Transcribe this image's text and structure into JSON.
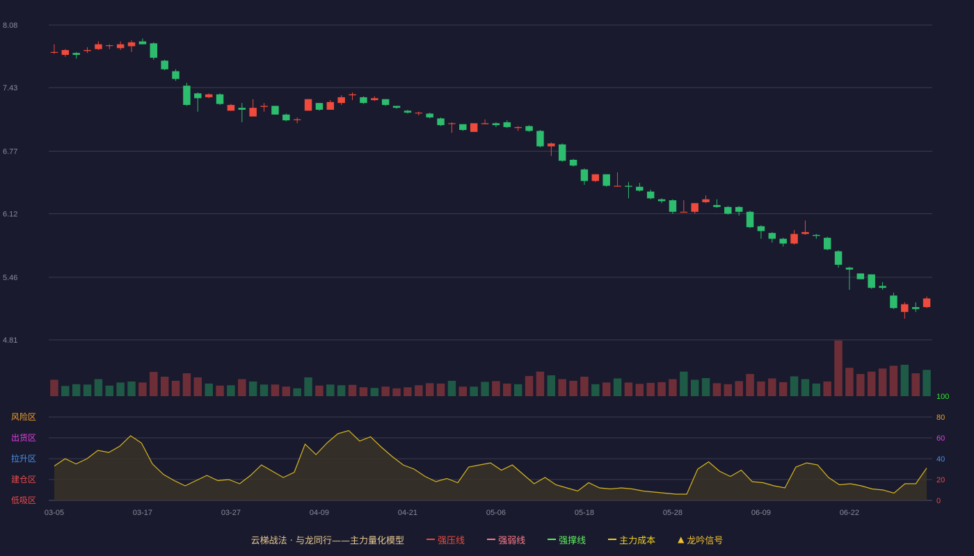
{
  "chart_data": {
    "type": "candlestick",
    "x_tick_labels": [
      "03-05",
      "03-17",
      "03-27",
      "04-09",
      "04-21",
      "05-06",
      "05-18",
      "05-28",
      "06-09",
      "06-22"
    ],
    "y_tick_labels": [
      "8.08",
      "7.43",
      "6.77",
      "6.12",
      "5.46",
      "4.81"
    ],
    "ylim": [
      4.81,
      8.08
    ],
    "grid": true,
    "candles": [
      [
        7.8,
        7.8,
        7.88,
        7.78
      ],
      [
        7.77,
        7.82,
        7.83,
        7.75
      ],
      [
        7.79,
        7.77,
        7.8,
        7.73
      ],
      [
        7.81,
        7.82,
        7.85,
        7.79
      ],
      [
        7.83,
        7.88,
        7.91,
        7.82
      ],
      [
        7.87,
        7.87,
        7.88,
        7.83
      ],
      [
        7.84,
        7.88,
        7.91,
        7.82
      ],
      [
        7.86,
        7.9,
        7.92,
        7.8
      ],
      [
        7.91,
        7.88,
        7.94,
        7.88
      ],
      [
        7.89,
        7.74,
        7.9,
        7.72
      ],
      [
        7.71,
        7.62,
        7.72,
        7.61
      ],
      [
        7.6,
        7.52,
        7.62,
        7.5
      ],
      [
        7.45,
        7.25,
        7.48,
        7.24
      ],
      [
        7.37,
        7.32,
        7.38,
        7.18
      ],
      [
        7.33,
        7.36,
        7.37,
        7.32
      ],
      [
        7.36,
        7.26,
        7.37,
        7.25
      ],
      [
        7.19,
        7.25,
        7.26,
        7.19
      ],
      [
        7.22,
        7.2,
        7.27,
        7.07
      ],
      [
        7.13,
        7.22,
        7.31,
        7.13
      ],
      [
        7.23,
        7.24,
        7.27,
        7.18
      ],
      [
        7.24,
        7.15,
        7.24,
        7.15
      ],
      [
        7.15,
        7.09,
        7.16,
        7.08
      ],
      [
        7.1,
        7.1,
        7.12,
        7.06
      ],
      [
        7.19,
        7.31,
        7.31,
        7.19
      ],
      [
        7.27,
        7.2,
        7.27,
        7.19
      ],
      [
        7.2,
        7.28,
        7.3,
        7.2
      ],
      [
        7.27,
        7.33,
        7.35,
        7.25
      ],
      [
        7.35,
        7.36,
        7.38,
        7.3
      ],
      [
        7.33,
        7.27,
        7.34,
        7.26
      ],
      [
        7.3,
        7.32,
        7.34,
        7.29
      ],
      [
        7.31,
        7.25,
        7.31,
        7.24
      ],
      [
        7.24,
        7.22,
        7.24,
        7.21
      ],
      [
        7.19,
        7.17,
        7.2,
        7.16
      ],
      [
        7.17,
        7.17,
        7.18,
        7.14
      ],
      [
        7.16,
        7.12,
        7.17,
        7.11
      ],
      [
        7.11,
        7.04,
        7.12,
        7.03
      ],
      [
        7.06,
        7.06,
        7.07,
        6.96
      ],
      [
        7.05,
        6.99,
        7.05,
        6.98
      ],
      [
        6.97,
        7.06,
        7.06,
        6.97
      ],
      [
        7.05,
        7.06,
        7.1,
        7.05
      ],
      [
        7.06,
        7.04,
        7.07,
        7.02
      ],
      [
        7.07,
        7.02,
        7.09,
        7.01
      ],
      [
        7.01,
        7.02,
        7.03,
        6.98
      ],
      [
        7.03,
        6.98,
        7.04,
        6.97
      ],
      [
        6.98,
        6.82,
        6.99,
        6.81
      ],
      [
        6.82,
        6.85,
        6.86,
        6.72
      ],
      [
        6.84,
        6.67,
        6.85,
        6.66
      ],
      [
        6.68,
        6.62,
        6.69,
        6.61
      ],
      [
        6.58,
        6.46,
        6.59,
        6.42
      ],
      [
        6.46,
        6.53,
        6.53,
        6.45
      ],
      [
        6.53,
        6.41,
        6.53,
        6.4
      ],
      [
        6.41,
        6.41,
        6.55,
        6.4
      ],
      [
        6.41,
        6.4,
        6.45,
        6.28
      ],
      [
        6.4,
        6.36,
        6.44,
        6.35
      ],
      [
        6.35,
        6.28,
        6.37,
        6.27
      ],
      [
        6.27,
        6.25,
        6.28,
        6.23
      ],
      [
        6.26,
        6.14,
        6.27,
        6.12
      ],
      [
        6.14,
        6.14,
        6.26,
        6.14
      ],
      [
        6.14,
        6.23,
        6.23,
        6.12
      ],
      [
        6.24,
        6.27,
        6.31,
        6.23
      ],
      [
        6.21,
        6.19,
        6.27,
        6.18
      ],
      [
        6.19,
        6.12,
        6.2,
        6.11
      ],
      [
        6.19,
        6.14,
        6.2,
        6.1
      ],
      [
        6.14,
        5.98,
        6.15,
        5.97
      ],
      [
        5.99,
        5.94,
        6.0,
        5.86
      ],
      [
        5.92,
        5.86,
        5.93,
        5.82
      ],
      [
        5.86,
        5.81,
        5.87,
        5.78
      ],
      [
        5.81,
        5.91,
        5.95,
        5.8
      ],
      [
        5.91,
        5.93,
        6.05,
        5.9
      ],
      [
        5.9,
        5.89,
        5.91,
        5.86
      ],
      [
        5.87,
        5.75,
        5.88,
        5.74
      ],
      [
        5.73,
        5.59,
        5.74,
        5.56
      ],
      [
        5.56,
        5.54,
        5.57,
        5.33
      ],
      [
        5.5,
        5.44,
        5.5,
        5.44
      ],
      [
        5.49,
        5.35,
        5.49,
        5.34
      ],
      [
        5.37,
        5.35,
        5.41,
        5.33
      ],
      [
        5.27,
        5.14,
        5.3,
        5.13
      ],
      [
        5.1,
        5.18,
        5.2,
        5.03
      ],
      [
        5.15,
        5.13,
        5.2,
        5.1
      ],
      [
        5.15,
        5.24,
        5.26,
        5.14
      ]
    ],
    "volume": [
      [
        48,
        0
      ],
      [
        30,
        1
      ],
      [
        35,
        1
      ],
      [
        34,
        1
      ],
      [
        50,
        1
      ],
      [
        31,
        1
      ],
      [
        40,
        1
      ],
      [
        43,
        1
      ],
      [
        40,
        0
      ],
      [
        71,
        0
      ],
      [
        57,
        0
      ],
      [
        45,
        0
      ],
      [
        67,
        0
      ],
      [
        55,
        0
      ],
      [
        37,
        1
      ],
      [
        31,
        0
      ],
      [
        32,
        1
      ],
      [
        50,
        0
      ],
      [
        43,
        1
      ],
      [
        34,
        1
      ],
      [
        34,
        0
      ],
      [
        28,
        0
      ],
      [
        23,
        1
      ],
      [
        55,
        1
      ],
      [
        31,
        0
      ],
      [
        34,
        1
      ],
      [
        32,
        1
      ],
      [
        33,
        0
      ],
      [
        26,
        0
      ],
      [
        24,
        1
      ],
      [
        28,
        0
      ],
      [
        23,
        0
      ],
      [
        26,
        0
      ],
      [
        32,
        0
      ],
      [
        38,
        0
      ],
      [
        37,
        0
      ],
      [
        45,
        1
      ],
      [
        28,
        0
      ],
      [
        28,
        1
      ],
      [
        42,
        1
      ],
      [
        44,
        0
      ],
      [
        37,
        0
      ],
      [
        35,
        1
      ],
      [
        59,
        0
      ],
      [
        72,
        0
      ],
      [
        61,
        1
      ],
      [
        50,
        0
      ],
      [
        45,
        0
      ],
      [
        57,
        0
      ],
      [
        35,
        1
      ],
      [
        40,
        0
      ],
      [
        52,
        1
      ],
      [
        40,
        0
      ],
      [
        36,
        0
      ],
      [
        39,
        0
      ],
      [
        41,
        0
      ],
      [
        50,
        0
      ],
      [
        72,
        1
      ],
      [
        48,
        1
      ],
      [
        53,
        1
      ],
      [
        38,
        0
      ],
      [
        35,
        0
      ],
      [
        44,
        0
      ],
      [
        65,
        0
      ],
      [
        43,
        0
      ],
      [
        52,
        0
      ],
      [
        41,
        0
      ],
      [
        58,
        1
      ],
      [
        50,
        1
      ],
      [
        37,
        1
      ],
      [
        43,
        0
      ],
      [
        163,
        0
      ],
      [
        83,
        0
      ],
      [
        65,
        0
      ],
      [
        72,
        0
      ],
      [
        81,
        0
      ],
      [
        89,
        0
      ],
      [
        92,
        1
      ],
      [
        67,
        0
      ],
      [
        77,
        1
      ]
    ],
    "indicator": {
      "series_name": "云梯战法 · 与龙同行——主力量化模型",
      "ylim": [
        0,
        100
      ],
      "values": [
        33,
        40,
        35,
        40,
        48,
        46,
        52,
        62,
        55,
        35,
        25,
        19,
        14,
        19,
        24,
        19,
        20,
        16,
        24,
        34,
        28,
        22,
        27,
        54,
        44,
        55,
        64,
        67,
        57,
        61,
        51,
        42,
        34,
        30,
        23,
        18,
        21,
        17,
        32,
        34,
        36,
        29,
        34,
        25,
        16,
        22,
        15,
        12,
        9,
        17,
        12,
        11,
        12,
        11,
        9,
        8,
        7,
        6,
        6,
        30,
        37,
        28,
        23,
        29,
        18,
        17,
        14,
        12,
        32,
        36,
        34,
        22,
        15,
        16,
        14,
        11,
        10,
        7,
        16,
        16,
        31
      ],
      "y_tick_labels": [
        "100",
        "80",
        "60",
        "40",
        "20",
        "0"
      ],
      "y_tick_colors": [
        "#30e830",
        "#f0a030",
        "#e040e0",
        "#4a90e8",
        "#e84a4a",
        "#e84a4a"
      ],
      "zones": [
        {
          "label": "风险区",
          "color": "#f0a030"
        },
        {
          "label": "出货区",
          "color": "#e040e0"
        },
        {
          "label": "拉升区",
          "color": "#4a90e8"
        },
        {
          "label": "建仓区",
          "color": "#e84a4a"
        },
        {
          "label": "低吸区",
          "color": "#e84a4a"
        }
      ]
    },
    "colors": {
      "up": "#ef4a3c",
      "down": "#2dbd6e",
      "volume_up": "#6e2e38",
      "volume_down": "#1e5a45",
      "indicator_line": "#d8b820",
      "indicator_fill": "#3a3228",
      "grid": "#3a3c50",
      "axis_text": "#8a8c9c"
    }
  },
  "legend": [
    {
      "label": "云梯战法 · 与龙同行——主力量化模型",
      "color": "#e8c890",
      "marker": ""
    },
    {
      "label": "强压线",
      "color": "#ef4a3c",
      "marker": "solid"
    },
    {
      "label": "强弱线",
      "color": "#ff7a8a",
      "marker": "dashed"
    },
    {
      "label": "强撑线",
      "color": "#5cf05c",
      "marker": "solid"
    },
    {
      "label": "主力成本",
      "color": "#f0d020",
      "marker": "dashed"
    },
    {
      "label": "龙吟信号",
      "color": "#f0c030",
      "marker": "triangle"
    }
  ]
}
